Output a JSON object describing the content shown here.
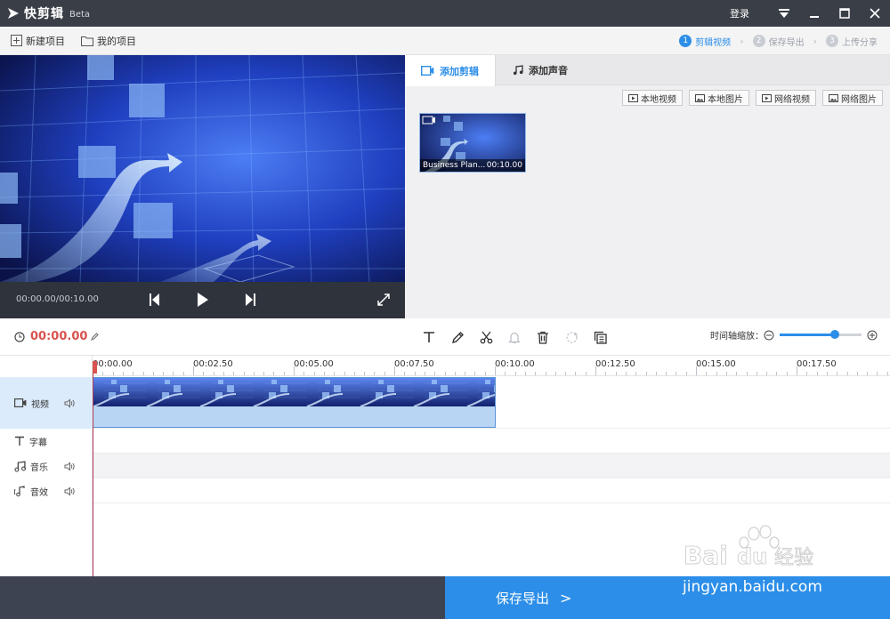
{
  "app": {
    "title": "快剪辑",
    "beta": "Beta"
  },
  "titlebar": {
    "login": "登录"
  },
  "toolbar": {
    "new_project": "新建项目",
    "my_projects": "我的项目",
    "steps": [
      {
        "num": "1",
        "label": "剪辑视频",
        "active": true
      },
      {
        "num": "2",
        "label": "保存导出",
        "active": false
      },
      {
        "num": "3",
        "label": "上传分享",
        "active": false
      }
    ]
  },
  "preview": {
    "time": "00:00.00/00:10.00"
  },
  "media": {
    "tabs": [
      "添加剪辑",
      "添加声音"
    ],
    "buttons": [
      "本地视频",
      "本地图片",
      "网络视频",
      "网络图片"
    ],
    "clip": {
      "name": "Business Plan...",
      "duration": "00:10.00"
    }
  },
  "timeline": {
    "current_time": "00:00.00",
    "zoom_label": "时间轴缩放：",
    "zoom_level": 0.67,
    "ticks": [
      "00:00.00",
      "00:02.50",
      "00:05.00",
      "00:07.50",
      "00:10.00",
      "00:12.50",
      "00:15.00",
      "00:17.50"
    ],
    "tracks": [
      "视频",
      "字幕",
      "音乐",
      "音效"
    ]
  },
  "footer": {
    "export_label": "保存导出",
    "arrow": ">"
  },
  "watermark": {
    "text": "jingyan.baidu.com",
    "logo": "Baidu经验"
  },
  "colors": {
    "accent": "#2c8ee8",
    "time_red": "#d9534f",
    "titlebar": "#3a3f47"
  }
}
